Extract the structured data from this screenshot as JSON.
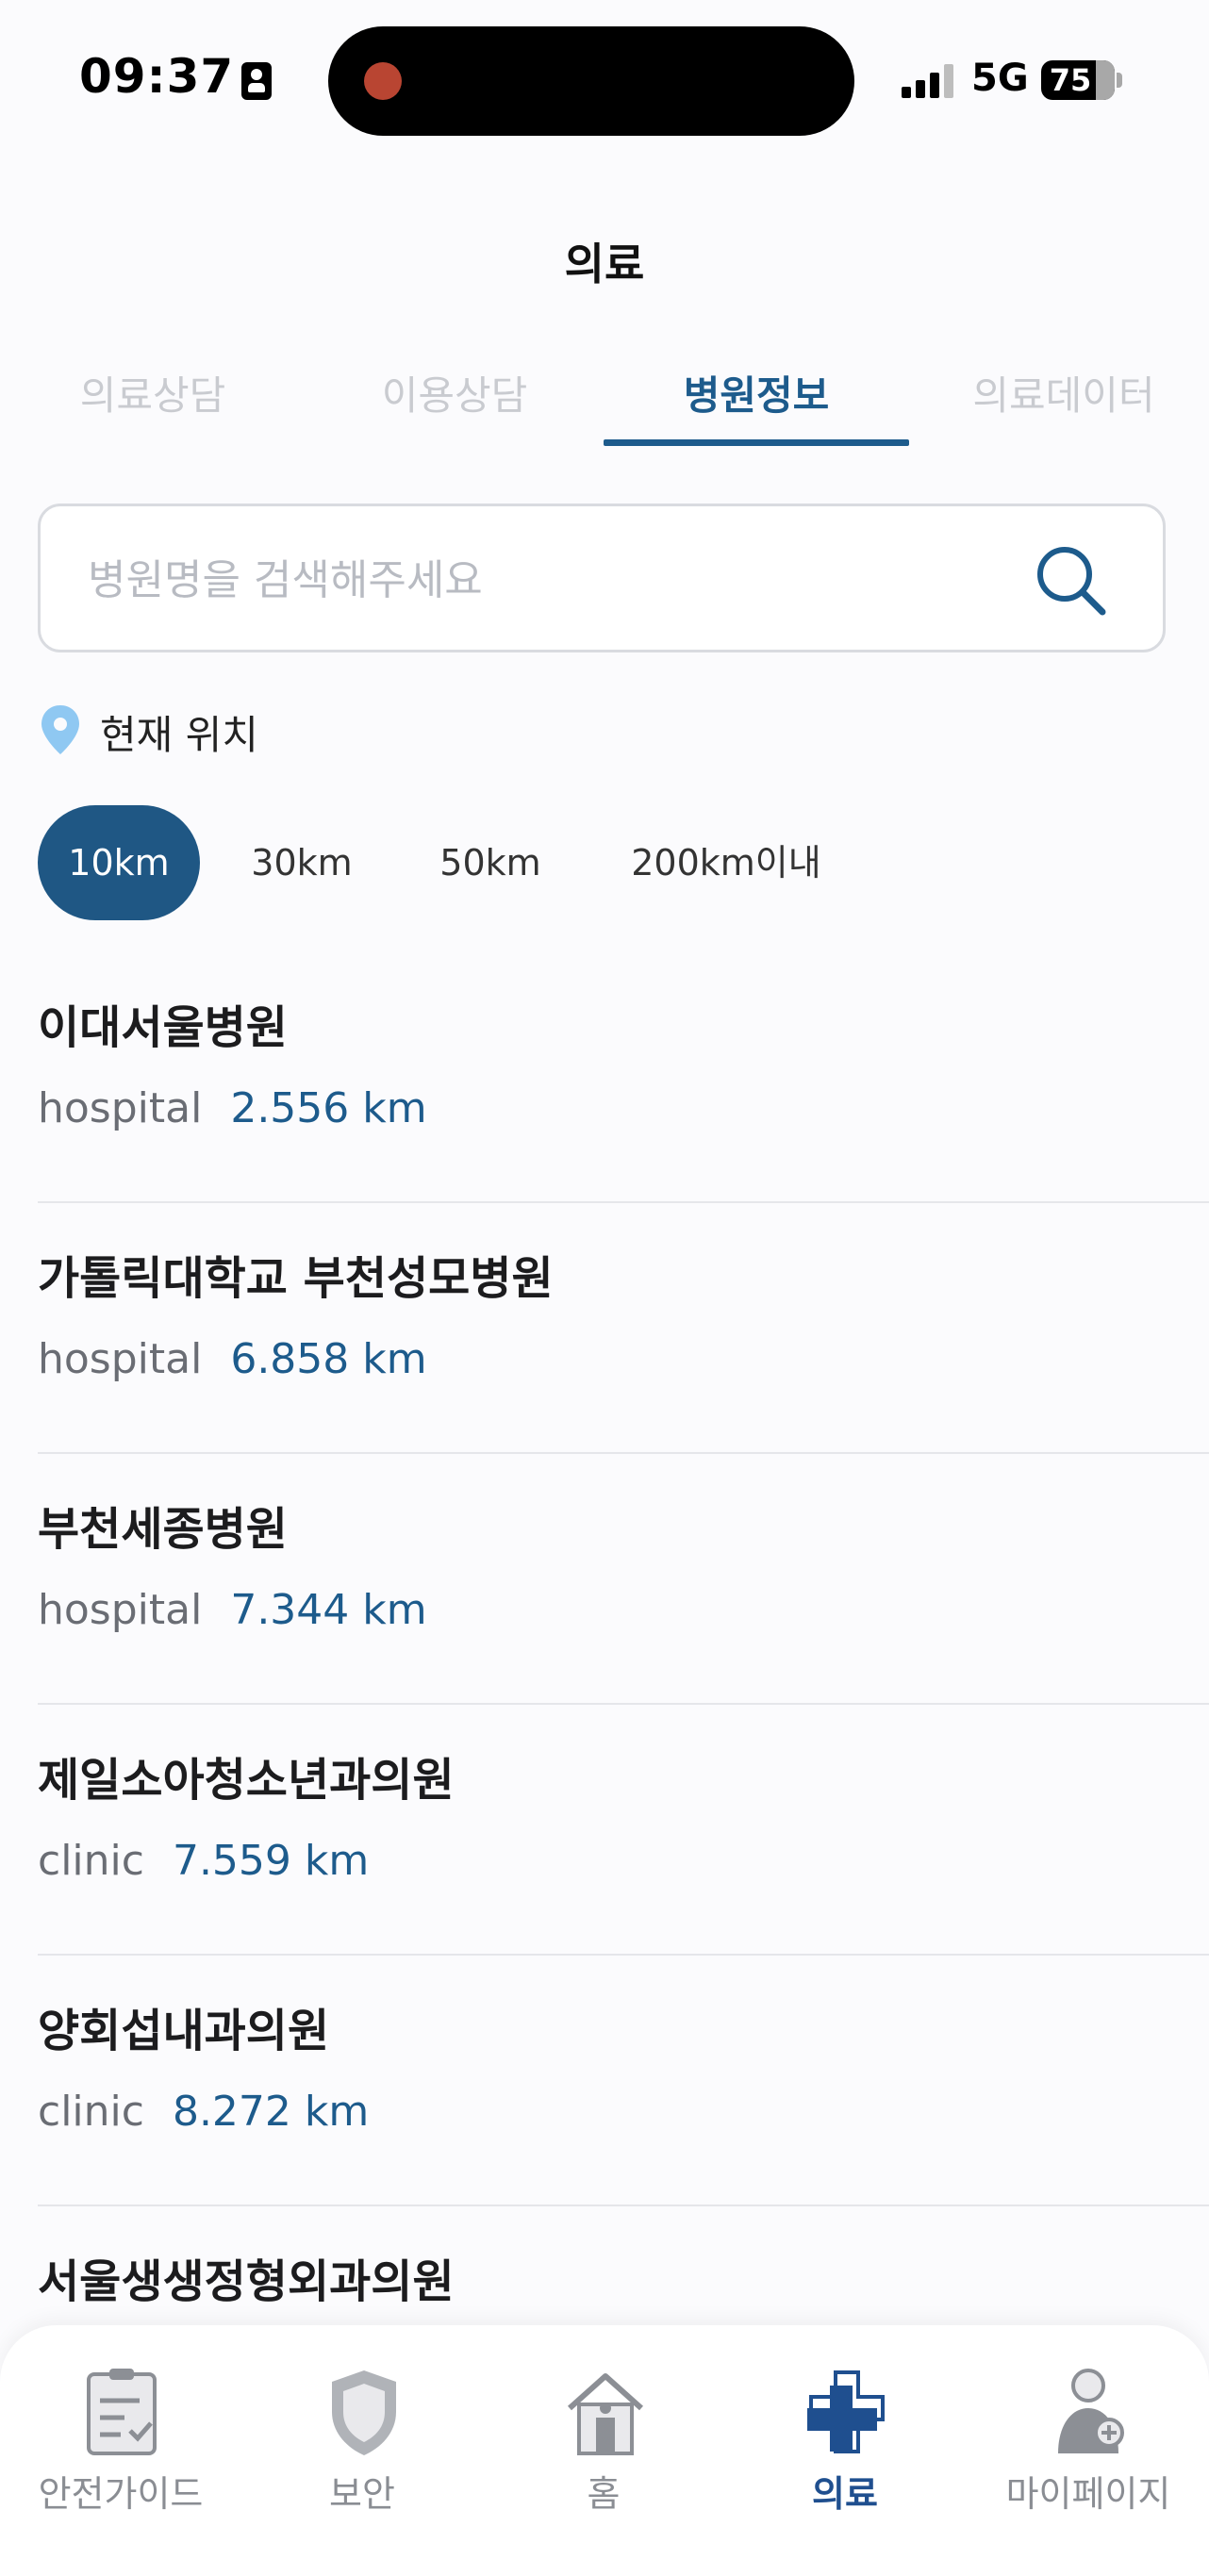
{
  "status_bar": {
    "time": "09:37",
    "network": "5G",
    "battery": "75"
  },
  "header": {
    "title": "의료"
  },
  "tabs": [
    {
      "label": "의료상담"
    },
    {
      "label": "이용상담"
    },
    {
      "label": "병원정보"
    },
    {
      "label": "의료데이터"
    }
  ],
  "search": {
    "placeholder": "병원명을 검색해주세요",
    "value": ""
  },
  "location": {
    "label": "현재 위치"
  },
  "distance_filters": [
    {
      "label": "10km"
    },
    {
      "label": "30km"
    },
    {
      "label": "50km"
    },
    {
      "label": "200km이내"
    }
  ],
  "hospitals": [
    {
      "name": "이대서울병원",
      "type": "hospital",
      "distance": "2.556 km"
    },
    {
      "name": "가톨릭대학교 부천성모병원",
      "type": "hospital",
      "distance": "6.858 km"
    },
    {
      "name": "부천세종병원",
      "type": "hospital",
      "distance": "7.344 km"
    },
    {
      "name": "제일소아청소년과의원",
      "type": "clinic",
      "distance": "7.559 km"
    },
    {
      "name": "양회섭내과의원",
      "type": "clinic",
      "distance": "8.272 km"
    },
    {
      "name": "서울생생정형외과의원",
      "type": "",
      "distance": ""
    }
  ],
  "bottom_nav": [
    {
      "label": "안전가이드",
      "icon": "checklist-icon"
    },
    {
      "label": "보안",
      "icon": "shield-icon"
    },
    {
      "label": "홈",
      "icon": "home-icon"
    },
    {
      "label": "의료",
      "icon": "medical-cross-icon"
    },
    {
      "label": "마이페이지",
      "icon": "user-icon"
    }
  ],
  "colors": {
    "accent": "#1d5b8c",
    "chip_active": "#1f5784",
    "nav_active": "#1f4f8f",
    "inactive_tab": "#c9cbd0",
    "pin": "#8fc8f2"
  }
}
